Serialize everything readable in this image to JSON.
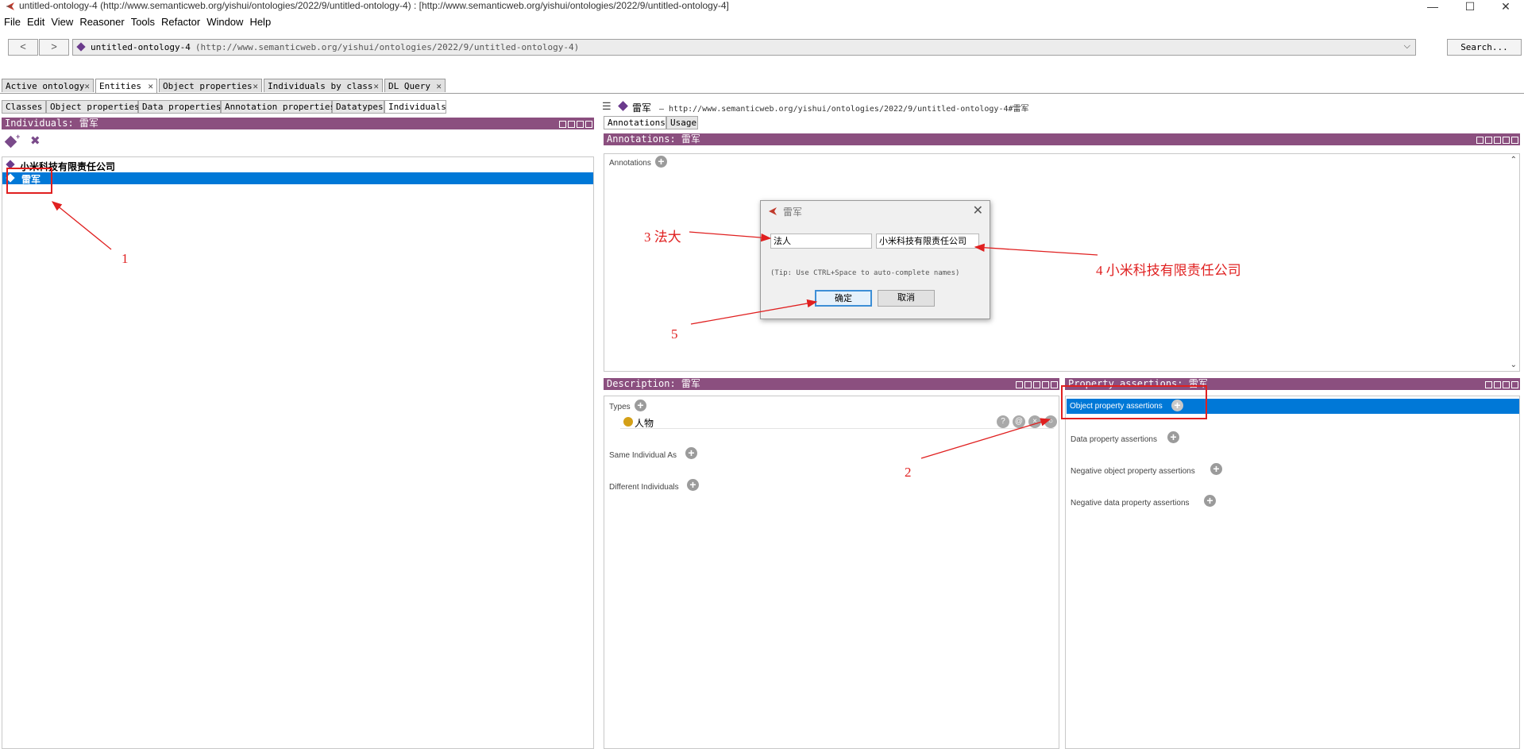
{
  "window": {
    "title": "untitled-ontology-4 (http://www.semanticweb.org/yishui/ontologies/2022/9/untitled-ontology-4)  : [http://www.semanticweb.org/yishui/ontologies/2022/9/untitled-ontology-4]",
    "controls": [
      "—",
      "☐",
      "✕"
    ]
  },
  "menu": [
    "File",
    "Edit",
    "View",
    "Reasoner",
    "Tools",
    "Refactor",
    "Window",
    "Help"
  ],
  "nav": {
    "back": "<",
    "forward": ">",
    "ontology_name": "untitled-ontology-4",
    "ontology_iri": "(http://www.semanticweb.org/yishui/ontologies/2022/9/untitled-ontology-4)",
    "search_label": "Search..."
  },
  "main_tabs": [
    {
      "label": "Active ontology",
      "active": false
    },
    {
      "label": "Entities",
      "active": true
    },
    {
      "label": "Object properties",
      "active": false
    },
    {
      "label": "Individuals by class",
      "active": false
    },
    {
      "label": "DL Query",
      "active": false
    }
  ],
  "left": {
    "sub_tabs": [
      "Classes",
      "Object properties",
      "Data properties",
      "Annotation properties",
      "Datatypes",
      "Individuals"
    ],
    "header": "Individuals: 雷军",
    "items": [
      {
        "label": "小米科技有限责任公司",
        "selected": false
      },
      {
        "label": "雷军",
        "selected": true
      }
    ]
  },
  "right": {
    "entity_name": "雷军",
    "entity_iri": "— http://www.semanticweb.org/yishui/ontologies/2022/9/untitled-ontology-4#雷军",
    "tabs": [
      "Annotations",
      "Usage"
    ],
    "annotations_header": "Annotations: 雷军",
    "annotations_label": "Annotations",
    "description_header": "Description: 雷军",
    "types_label": "Types",
    "type_value": "人物",
    "same_individual": "Same Individual As",
    "different_individuals": "Different Individuals",
    "property_header": "Property assertions: 雷军",
    "object_property_assertions": "Object property assertions",
    "data_property_assertions": "Data property assertions",
    "negative_object_property_assertions": "Negative object property assertions",
    "negative_data_property_assertions": "Negative data property assertions"
  },
  "dialog": {
    "title": "雷军",
    "property_value": "法人",
    "individual_value": "小米科技有限责任公司",
    "tip": "(Tip: Use CTRL+Space to auto-complete names)",
    "ok": "确定",
    "cancel": "取消"
  },
  "annotations_overlay": {
    "a1": "1",
    "a2": "2",
    "a3": "3  法大",
    "a4": "4  小米科技有限责任公司",
    "a5": "5"
  },
  "colors": {
    "header_purple": "#8b4f7f",
    "selection_blue": "#0078d7",
    "annotation_red": "#e02020",
    "type_dot": "#d4a017"
  }
}
